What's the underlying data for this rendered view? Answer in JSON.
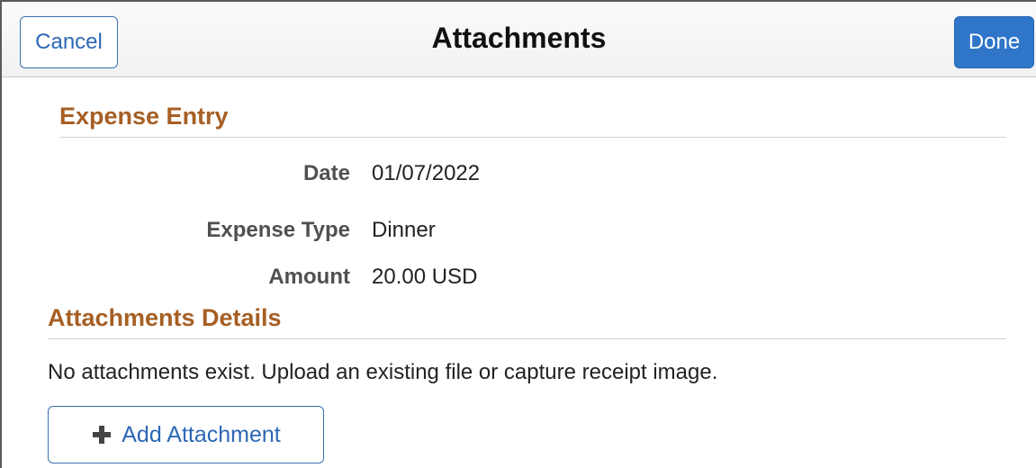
{
  "header": {
    "cancel_label": "Cancel",
    "title": "Attachments",
    "done_label": "Done"
  },
  "expense_entry": {
    "section_title": "Expense Entry",
    "fields": [
      {
        "label": "Date",
        "value": "01/07/2022"
      },
      {
        "label": "Expense Type",
        "value": "Dinner"
      },
      {
        "label": "Amount",
        "value": "20.00 USD"
      }
    ]
  },
  "attachments_details": {
    "section_title": "Attachments Details",
    "empty_message": "No attachments exist. Upload an existing file or capture receipt image.",
    "add_button_label": "Add Attachment",
    "add_button_icon": "plus-icon"
  },
  "colors": {
    "section_title": "#a65f24",
    "link_blue": "#2c68b5",
    "done_bg": "#2f76c9"
  }
}
